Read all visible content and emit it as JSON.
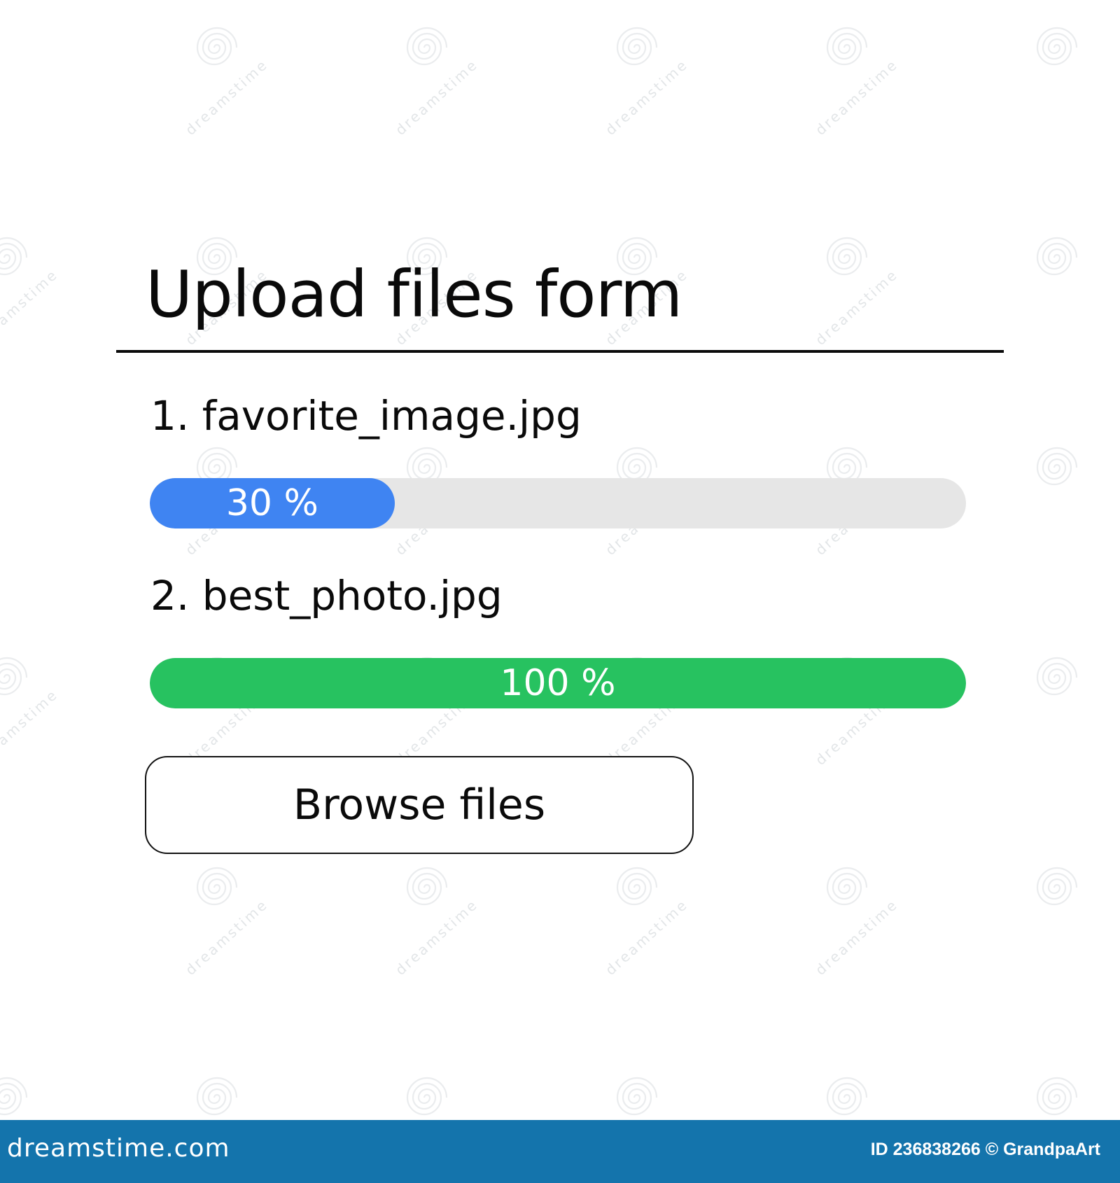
{
  "form": {
    "title": "Upload files form"
  },
  "files": [
    {
      "name": "1. favorite_image.jpg",
      "progress": 30,
      "progress_label": "30 %",
      "color": "#3f84f2"
    },
    {
      "name": "2. best_photo.jpg",
      "progress": 100,
      "progress_label": "100 %",
      "color": "#27c260"
    }
  ],
  "actions": {
    "browse_label": "Browse files"
  },
  "footer": {
    "logo_text": "dreamstime.com",
    "credit": "ID 236838266 © GrandpaArt",
    "background_color": "#1474ac"
  },
  "watermark": {
    "text": "dreamstime",
    "icon": "swirl-watermark-icon"
  },
  "colors": {
    "track": "#e6e6e6",
    "text": "#0a0a0a"
  }
}
